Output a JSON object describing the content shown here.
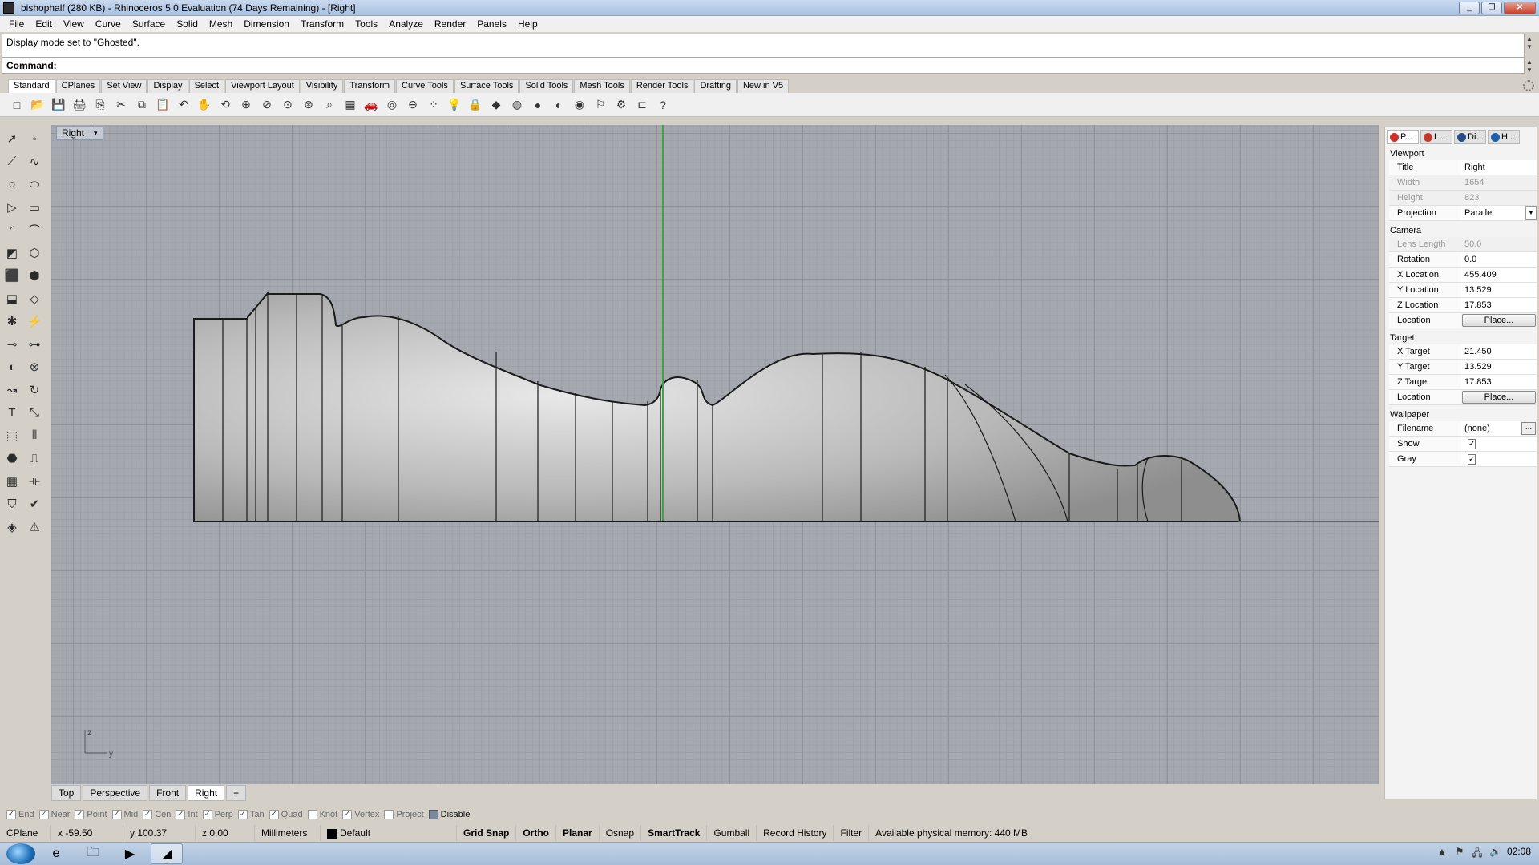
{
  "window": {
    "title": "bishophalf (280 KB) - Rhinoceros 5.0 Evaluation (74 Days Remaining) - [Right]",
    "minimize": "_",
    "restore": "❐",
    "close": "✕"
  },
  "menu": [
    "File",
    "Edit",
    "View",
    "Curve",
    "Surface",
    "Solid",
    "Mesh",
    "Dimension",
    "Transform",
    "Tools",
    "Analyze",
    "Render",
    "Panels",
    "Help"
  ],
  "command": {
    "history": "Display mode set to \"Ghosted\".",
    "prompt_label": "Command:",
    "value": ""
  },
  "toolbar_tabs": [
    "Standard",
    "CPlanes",
    "Set View",
    "Display",
    "Select",
    "Viewport Layout",
    "Visibility",
    "Transform",
    "Curve Tools",
    "Surface Tools",
    "Solid Tools",
    "Mesh Tools",
    "Render Tools",
    "Drafting",
    "New in V5"
  ],
  "main_toolbar_icons": [
    "new-file-icon",
    "open-file-icon",
    "save-icon",
    "print-icon",
    "import-icon",
    "cut-icon",
    "copy-icon",
    "paste-icon",
    "undo-icon",
    "pan-icon",
    "rotate-view-icon",
    "zoom-icon",
    "zoom-window-icon",
    "zoom-extents-icon",
    "zoom-selected-icon",
    "zoom-dynamic-icon",
    "four-viewports-icon",
    "car-icon",
    "spacemouse-icon",
    "cplane-icon",
    "points-icon",
    "light-bulb-icon",
    "lock-icon",
    "layer-icon",
    "color-wheel-icon",
    "shaded-sphere-icon",
    "rendered-sphere-icon",
    "render-sphere-icon",
    "filter-icon",
    "options-gear-icon",
    "dimension-icon",
    "help-icon"
  ],
  "main_toolbar_glyphs": [
    "□",
    "📂",
    "💾",
    "🖨",
    "⎘",
    "✂",
    "⧉",
    "📋",
    "↶",
    "✋",
    "⟲",
    "⊕",
    "⊘",
    "⊙",
    "⊛",
    "⌕",
    "▦",
    "🚗",
    "◎",
    "⊖",
    "⁘",
    "💡",
    "🔒",
    "◆",
    "◍",
    "●",
    "◐",
    "◉",
    "⚐",
    "⚙",
    "⊏",
    "?"
  ],
  "left_toolbar_icons": [
    "select-arrow-icon",
    "point-icon",
    "polyline-icon",
    "curve-icon",
    "circle-icon",
    "ellipse-icon",
    "polygon-icon",
    "rectangle-icon",
    "arc-icon",
    "fillet-curve-icon",
    "surface-icon",
    "loft-icon",
    "box-icon",
    "boolean-icon",
    "extrude-icon",
    "offset-surface-icon",
    "explode-icon",
    "trim-icon",
    "split-icon",
    "join-icon",
    "group-icon",
    "ungroup-icon",
    "move-icon",
    "rotate-icon",
    "text-icon",
    "scale-icon",
    "array-icon",
    "mirror-icon",
    "mesh-icon",
    "dimension-icon",
    "grid-array-icon",
    "align-icon",
    "analyze-icon",
    "check-icon",
    "render-icon",
    "cleanup-icon"
  ],
  "left_toolbar_glyphs": [
    "➚",
    "◦",
    "⟋",
    "∿",
    "○",
    "⬭",
    "▷",
    "▭",
    "◜",
    "⌒",
    "◩",
    "⬡",
    "⬛",
    "⬢",
    "⬓",
    "◇",
    "✱",
    "⚡",
    "⊸",
    "⊶",
    "◐",
    "⊗",
    "↝",
    "↻",
    "T",
    "⤡",
    "⬚",
    "⫴",
    "⬣",
    "⎍",
    "▦",
    "⟛",
    "⛉",
    "✔",
    "◈",
    "⚠"
  ],
  "viewport": {
    "label": "Right",
    "dropdown": "▾",
    "axis_z": "z",
    "axis_y": "y"
  },
  "viewport_tabs": [
    "Top",
    "Perspective",
    "Front",
    "Right",
    "+"
  ],
  "active_viewport_tab": "Right",
  "panel_tabs": [
    {
      "label": "P...",
      "icon": "properties-icon",
      "color": "#d0312d"
    },
    {
      "label": "L...",
      "icon": "layers-icon",
      "color": "#c0392b"
    },
    {
      "label": "Di...",
      "icon": "display-icon",
      "color": "#2b4c7e"
    },
    {
      "label": "H...",
      "icon": "help-panel-icon",
      "color": "#1f5fa8"
    }
  ],
  "properties": {
    "viewport_section": "Viewport",
    "title_k": "Title",
    "title_v": "Right",
    "width_k": "Width",
    "width_v": "1654",
    "height_k": "Height",
    "height_v": "823",
    "projection_k": "Projection",
    "projection_v": "Parallel",
    "camera_section": "Camera",
    "lens_k": "Lens Length",
    "lens_v": "50.0",
    "rotation_k": "Rotation",
    "rotation_v": "0.0",
    "xloc_k": "X Location",
    "xloc_v": "455.409",
    "yloc_k": "Y Location",
    "yloc_v": "13.529",
    "zloc_k": "Z Location",
    "zloc_v": "17.853",
    "loc_k": "Location",
    "place_btn": "Place...",
    "target_section": "Target",
    "xt_k": "X Target",
    "xt_v": "21.450",
    "yt_k": "Y Target",
    "yt_v": "13.529",
    "zt_k": "Z Target",
    "zt_v": "17.853",
    "tloc_k": "Location",
    "tplace_btn": "Place...",
    "wallpaper_section": "Wallpaper",
    "filename_k": "Filename",
    "filename_v": "(none)",
    "browse": "...",
    "show_k": "Show",
    "show_checked": true,
    "gray_k": "Gray",
    "gray_checked": true,
    "check_glyph": "✓"
  },
  "osnaps": [
    {
      "label": "End",
      "checked": true
    },
    {
      "label": "Near",
      "checked": true
    },
    {
      "label": "Point",
      "checked": true
    },
    {
      "label": "Mid",
      "checked": true
    },
    {
      "label": "Cen",
      "checked": true
    },
    {
      "label": "Int",
      "checked": true
    },
    {
      "label": "Perp",
      "checked": true
    },
    {
      "label": "Tan",
      "checked": true
    },
    {
      "label": "Quad",
      "checked": true
    },
    {
      "label": "Knot",
      "checked": false
    },
    {
      "label": "Vertex",
      "checked": true
    },
    {
      "label": "Project",
      "checked": false
    },
    {
      "label": "Disable",
      "checked": false
    }
  ],
  "status": {
    "cplane": "CPlane",
    "x": "x -59.50",
    "y": "y 100.37",
    "z": "z 0.00",
    "units": "Millimeters",
    "layer": "Default",
    "grid_snap": "Grid Snap",
    "ortho": "Ortho",
    "planar": "Planar",
    "osnap": "Osnap",
    "smarttrack": "SmartTrack",
    "gumball": "Gumball",
    "record_history": "Record History",
    "filter": "Filter",
    "memory": "Available physical memory: 440 MB"
  },
  "taskbar": {
    "apps": [
      "ie-icon",
      "explorer-icon",
      "media-player-icon",
      "rhino-icon"
    ],
    "app_glyphs": [
      "e",
      "🗀",
      "▶",
      "◢"
    ],
    "clock": "02:08",
    "tray_glyphs": [
      "▲",
      "⚑",
      "🖧",
      "🔊"
    ]
  },
  "colors": {
    "viewport_bg": "#a5a9af",
    "axis_green": "#39a83c",
    "axis_red": "#c0392b",
    "selected_tab": "#ffffff"
  }
}
